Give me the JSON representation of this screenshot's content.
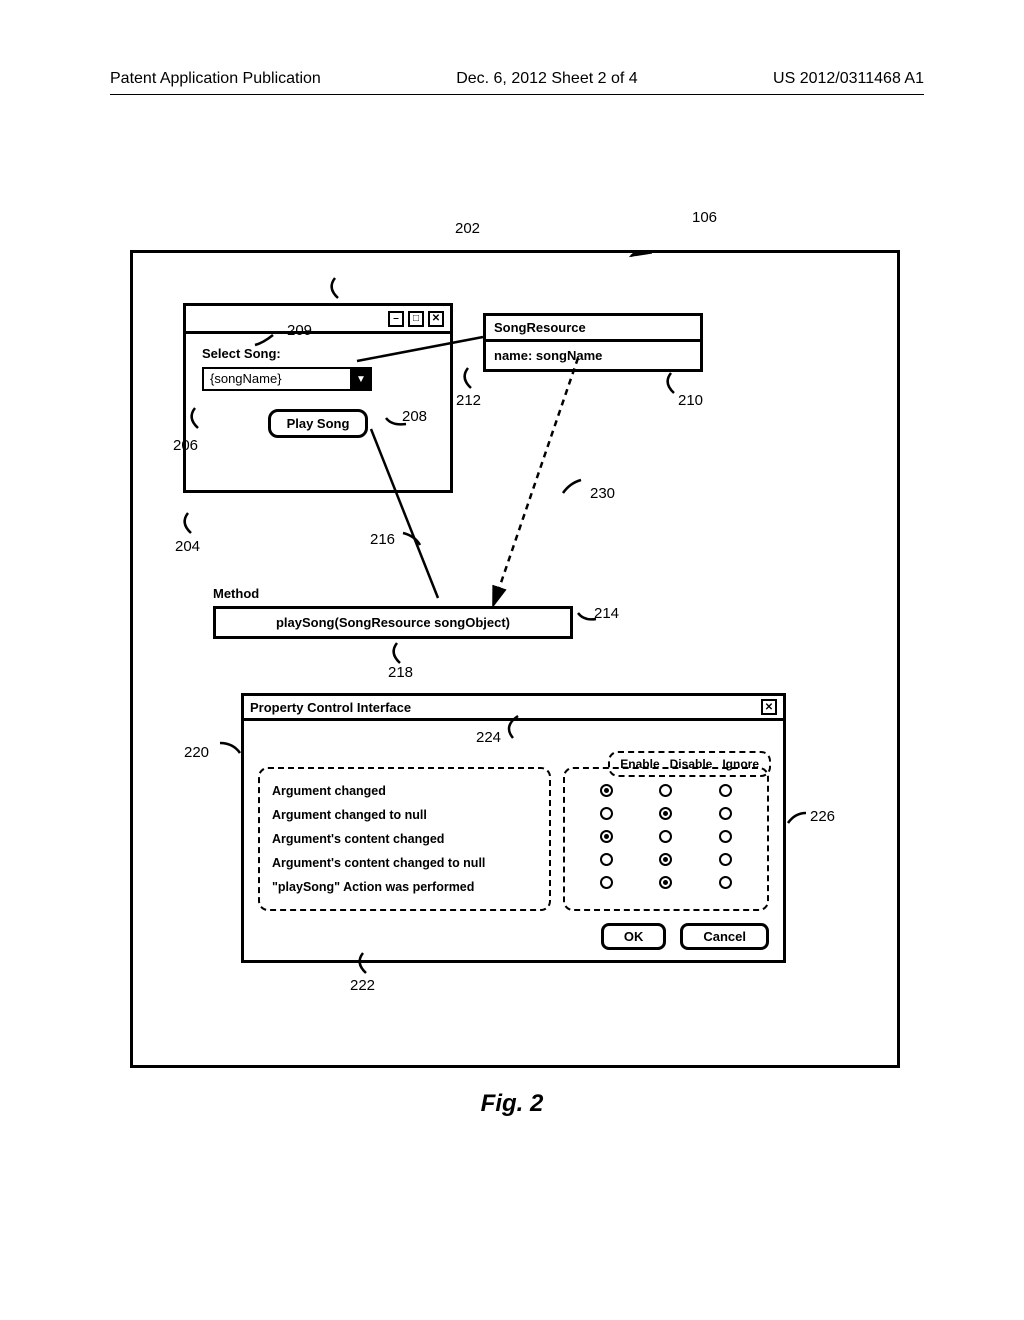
{
  "header": {
    "left": "Patent Application Publication",
    "center": "Dec. 6, 2012   Sheet 2 of 4",
    "right": "US 2012/0311468 A1"
  },
  "figure_caption": "Fig. 2",
  "refs": {
    "r106": "106",
    "r202": "202",
    "r204": "204",
    "r206": "206",
    "r208": "208",
    "r209": "209",
    "r210": "210",
    "r212": "212",
    "r214": "214",
    "r216": "216",
    "r218": "218",
    "r220": "220",
    "r222": "222",
    "r224": "224",
    "r226": "226",
    "r230": "230"
  },
  "song_window": {
    "select_label": "Select Song:",
    "dropdown_value": "{songName}",
    "play_label": "Play Song"
  },
  "song_resource": {
    "title": "SongResource",
    "body": "name: songName"
  },
  "method": {
    "label": "Method",
    "body": "playSong(SongResource songObject)"
  },
  "pci": {
    "title": "Property Control Interface",
    "columns": [
      "Enable",
      "Disable",
      "Ignore"
    ],
    "rows": [
      {
        "label": "Argument changed",
        "selected": 0
      },
      {
        "label": "Argument changed to null",
        "selected": 1
      },
      {
        "label": "Argument's content changed",
        "selected": 0
      },
      {
        "label": "Argument's content changed to null",
        "selected": 1
      },
      {
        "label": "\"playSong\" Action was performed",
        "selected": 1
      }
    ],
    "ok": "OK",
    "cancel": "Cancel"
  }
}
